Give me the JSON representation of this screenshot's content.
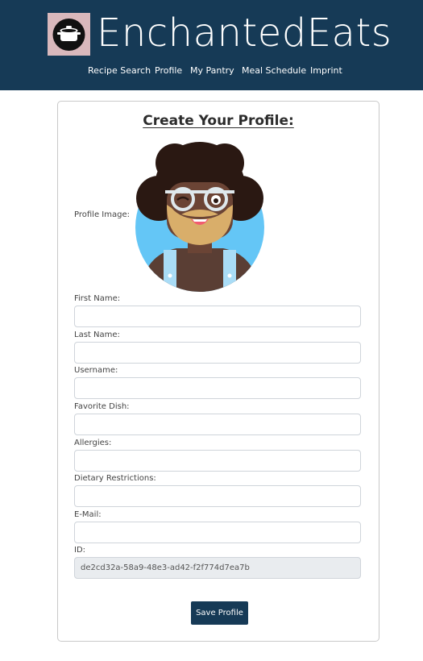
{
  "header": {
    "brand": "EnchantedEats",
    "logo_icon": "cooking-pot-icon",
    "background_color": "#163a56",
    "nav": [
      {
        "label": "Recipe Search"
      },
      {
        "label": "Profile"
      },
      {
        "label": "My Pantry"
      },
      {
        "label": "Meal Schedule"
      },
      {
        "label": "Imprint"
      }
    ]
  },
  "form": {
    "title": "Create Your Profile:",
    "profile_image_label": "Profile Image:",
    "avatar_icon": "bearded-man-avatar",
    "fields": [
      {
        "label": "First Name:",
        "value": ""
      },
      {
        "label": "Last Name:",
        "value": ""
      },
      {
        "label": "Username:",
        "value": ""
      },
      {
        "label": "Favorite Dish:",
        "value": ""
      },
      {
        "label": "Allergies:",
        "value": ""
      },
      {
        "label": "Dietary Restrictions:",
        "value": ""
      },
      {
        "label": "E-Mail:",
        "value": ""
      }
    ],
    "id_field": {
      "label": "ID:",
      "value": "de2cd32a-58a9-48e3-ad42-f2f774d7ea7b"
    },
    "save_label": "Save Profile"
  }
}
